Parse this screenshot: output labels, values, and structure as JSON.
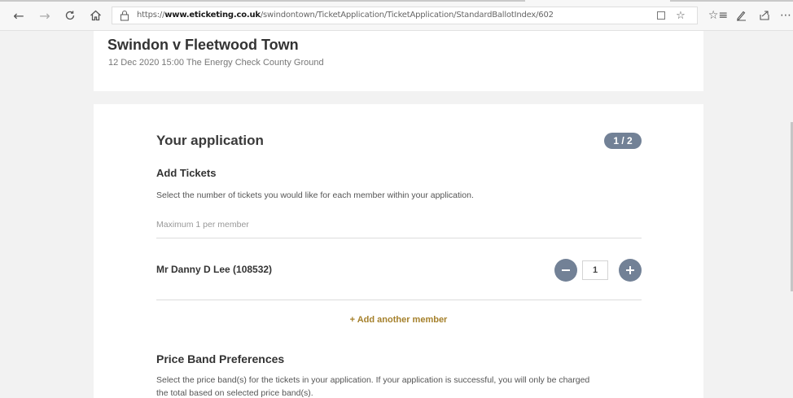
{
  "browser": {
    "url_prefix": "https://",
    "url_host": "www.eticketing.co.uk",
    "url_path": "/swindontown/TicketApplication/TicketApplication/StandardBallotIndex/602",
    "icons": [
      "back-icon",
      "forward-icon",
      "refresh-icon",
      "home-icon",
      "lock-icon",
      "reading-view-icon",
      "favorite-star-icon",
      "favorites-hub-icon",
      "pen-icon",
      "share-icon",
      "more-icon"
    ]
  },
  "match": {
    "title": "Swindon v Fleetwood Town",
    "subtitle": "12 Dec 2020 15:00 The Energy Check County Ground"
  },
  "application": {
    "heading": "Your application",
    "step": "1 / 2",
    "add_tickets_heading": "Add Tickets",
    "add_tickets_desc": "Select the number of tickets you would like for each member within your application.",
    "max_note": "Maximum 1 per member",
    "members": [
      {
        "name": "Mr Danny D Lee (108532)",
        "quantity": "1"
      }
    ],
    "add_member_link": "+ Add another member",
    "price_heading": "Price Band Preferences",
    "price_desc_line1": "Select the price band(s) for the tickets in your application. If your application is successful, you will only be charged",
    "price_desc_line2": "the total based on selected price band(s)."
  },
  "colors": {
    "accent_pill": "#728196",
    "link_gold": "#a5802b",
    "card_bg": "#ffffff",
    "page_bg": "#f2f2f2"
  }
}
